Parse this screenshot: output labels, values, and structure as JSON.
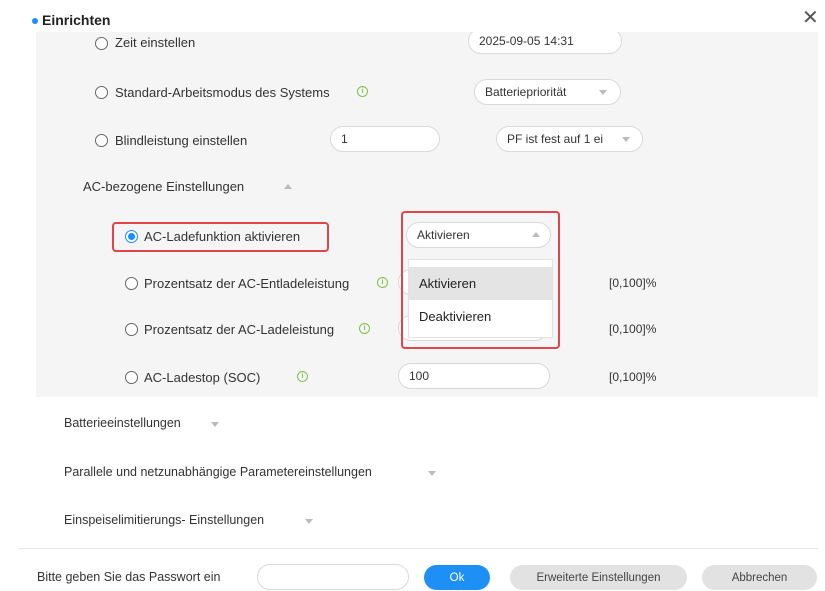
{
  "dialog": {
    "title": "Einrichten",
    "close_icon": "close-icon",
    "accent_color": "#1890ff",
    "highlight_color": "#e0454a"
  },
  "settings": {
    "time": {
      "label": "Zeit einstellen",
      "value": "2025-09-05 14:31"
    },
    "work_mode": {
      "label": "Standard-Arbeitsmodus des Systems",
      "value": "Batteriepriorität"
    },
    "reactive_power": {
      "label": "Blindleistung einstellen",
      "value": "1",
      "mode": "PF ist fest auf 1 ei"
    },
    "ac_section": {
      "label": "AC-bezogene Einstellungen",
      "ac_charge": {
        "label": "AC-Ladefunktion aktivieren",
        "value": "Aktivieren"
      },
      "discharge_pct": {
        "label": "Prozentsatz der AC-Entladeleistung",
        "range": "[0,100]%"
      },
      "charge_pct": {
        "label": "Prozentsatz der AC-Ladeleistung",
        "range": "[0,100]%"
      },
      "charge_stop": {
        "label": "AC-Ladestop (SOC)",
        "value": "100",
        "range": "[0,100]%"
      }
    }
  },
  "dropdown": {
    "options": [
      "Aktivieren",
      "Deaktivieren"
    ],
    "selected": "Aktivieren"
  },
  "sections": [
    {
      "label": "Batterieeinstellungen"
    },
    {
      "label": "Parallele und netzunabhängige Parametereinstellungen"
    },
    {
      "label": "Einspeiselimitierungs- Einstellungen"
    }
  ],
  "footer": {
    "password_label": "Bitte geben Sie das Passwort ein",
    "password_value": "",
    "ok": "Ok",
    "advanced": "Erweiterte Einstellungen",
    "cancel": "Abbrechen"
  }
}
